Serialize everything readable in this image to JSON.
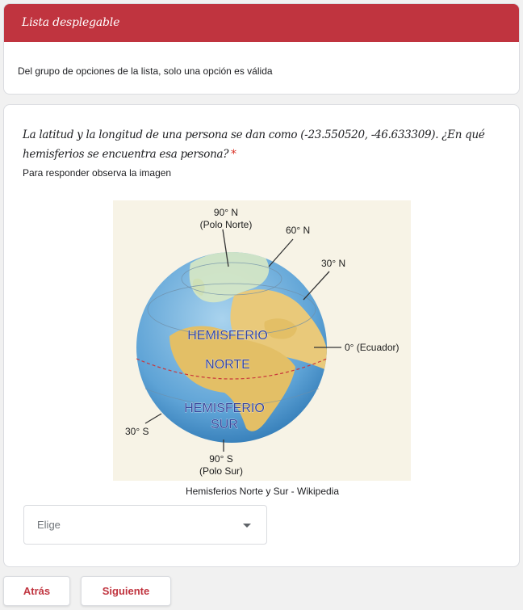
{
  "section": {
    "title": "Lista desplegable",
    "description": "Del grupo de opciones de la lista, solo una opción es válida"
  },
  "question": {
    "title": "La latitud y la longitud de una persona se dan como (-23.550520, -46.633309). ¿En qué hemisferios se encuentra esa persona?",
    "required_mark": "*",
    "help_text": "Para responder observa la imagen",
    "image_caption": "Hemisferios Norte y Sur - Wikipedia",
    "dropdown": {
      "selected": "Elige"
    }
  },
  "globe": {
    "label_90n_deg": "90° N",
    "label_90n_name": "(Polo Norte)",
    "label_60n": "60° N",
    "label_30n": "30° N",
    "label_equator": "0° (Ecuador)",
    "label_30s": "30° S",
    "label_90s_deg": "90° S",
    "label_90s_name": "(Polo Sur)",
    "hemi_north_1": "HEMISFERIO",
    "hemi_north_2": "NORTE",
    "hemi_south_1": "HEMISFERIO",
    "hemi_south_2": "SUR"
  },
  "navigation": {
    "back": "Atrás",
    "next": "Siguiente"
  },
  "colors": {
    "accent": "#c0343f",
    "required": "#d93025"
  }
}
